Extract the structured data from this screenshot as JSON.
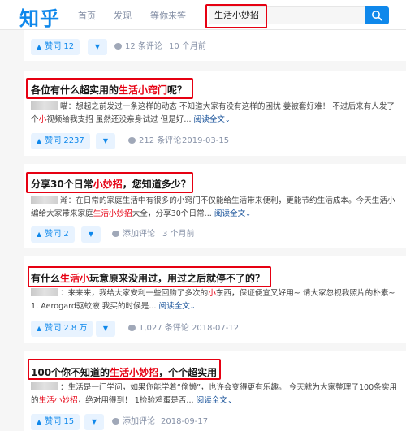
{
  "header": {
    "logo": "知乎",
    "nav": [
      "首页",
      "发现",
      "等你来答"
    ],
    "search_value": "生活小妙招",
    "colors": {
      "brand": "#0f88eb",
      "highlight": "#e60012"
    }
  },
  "cards": [
    {
      "title": null,
      "excerpt_tail": "",
      "upvote": "赞同 12",
      "comments": "12 条评论",
      "date": "10 个月前"
    },
    {
      "title_parts": [
        "各位有什么超实用的",
        "生活小窍门",
        "呢？"
      ],
      "author": "喵",
      "excerpt_parts": [
        "：想起之前发过一条这样的动态 不知道大家有没有这样的困扰 姜被套好难！ 不过后来有人发了个",
        "小",
        "视频给我支招 虽然还没亲身试过 但是好..."
      ],
      "more": "阅读全文",
      "upvote": "赞同 2237",
      "comments": "212 条评论",
      "date": "2019-03-15"
    },
    {
      "title_parts": [
        "分享30个日常",
        "小妙招",
        "，您知道多少？"
      ],
      "author": "瀚",
      "excerpt_parts": [
        "：在日常的家庭生活中有很多的小窍门不仅能给生活带来便利，更能节约生活成本。今天生活小编给大家带来家庭",
        "生活小妙招",
        "大全，分享30个日常..."
      ],
      "more": "阅读全文",
      "upvote": "赞同 2",
      "comments": "添加评论",
      "date": "3 个月前"
    },
    {
      "title_parts": [
        "有什么",
        "生活小",
        "玩意原来没用过，用过之后就停不了的？"
      ],
      "author": "",
      "excerpt_parts": [
        "：来来来，我给大家安利一些回购了多次的",
        "小",
        "东西，保证便宜又好用~ 请大家忽视我照片的朴素~ 1. Aerogard驱蚊液 我买的时候是..."
      ],
      "more": "阅读全文",
      "upvote": "赞同 2.8 万",
      "comments": "1,027 条评论",
      "date": "2018-07-12"
    },
    {
      "title_parts": [
        "100个你不知道的",
        "生活小妙招",
        "，个个超实用"
      ],
      "author": "",
      "excerpt_parts": [
        "：生活是一门学问，如果你能学着“偷懒”，也许会变得更有乐趣。 今天就为大家整理了100条实用的",
        "生活小妙招",
        "，绝对用得到！ 1检验鸡蛋是否..."
      ],
      "more": "阅读全文",
      "upvote": "赞同 15",
      "comments": "添加评论",
      "date": "2018-09-17"
    }
  ]
}
